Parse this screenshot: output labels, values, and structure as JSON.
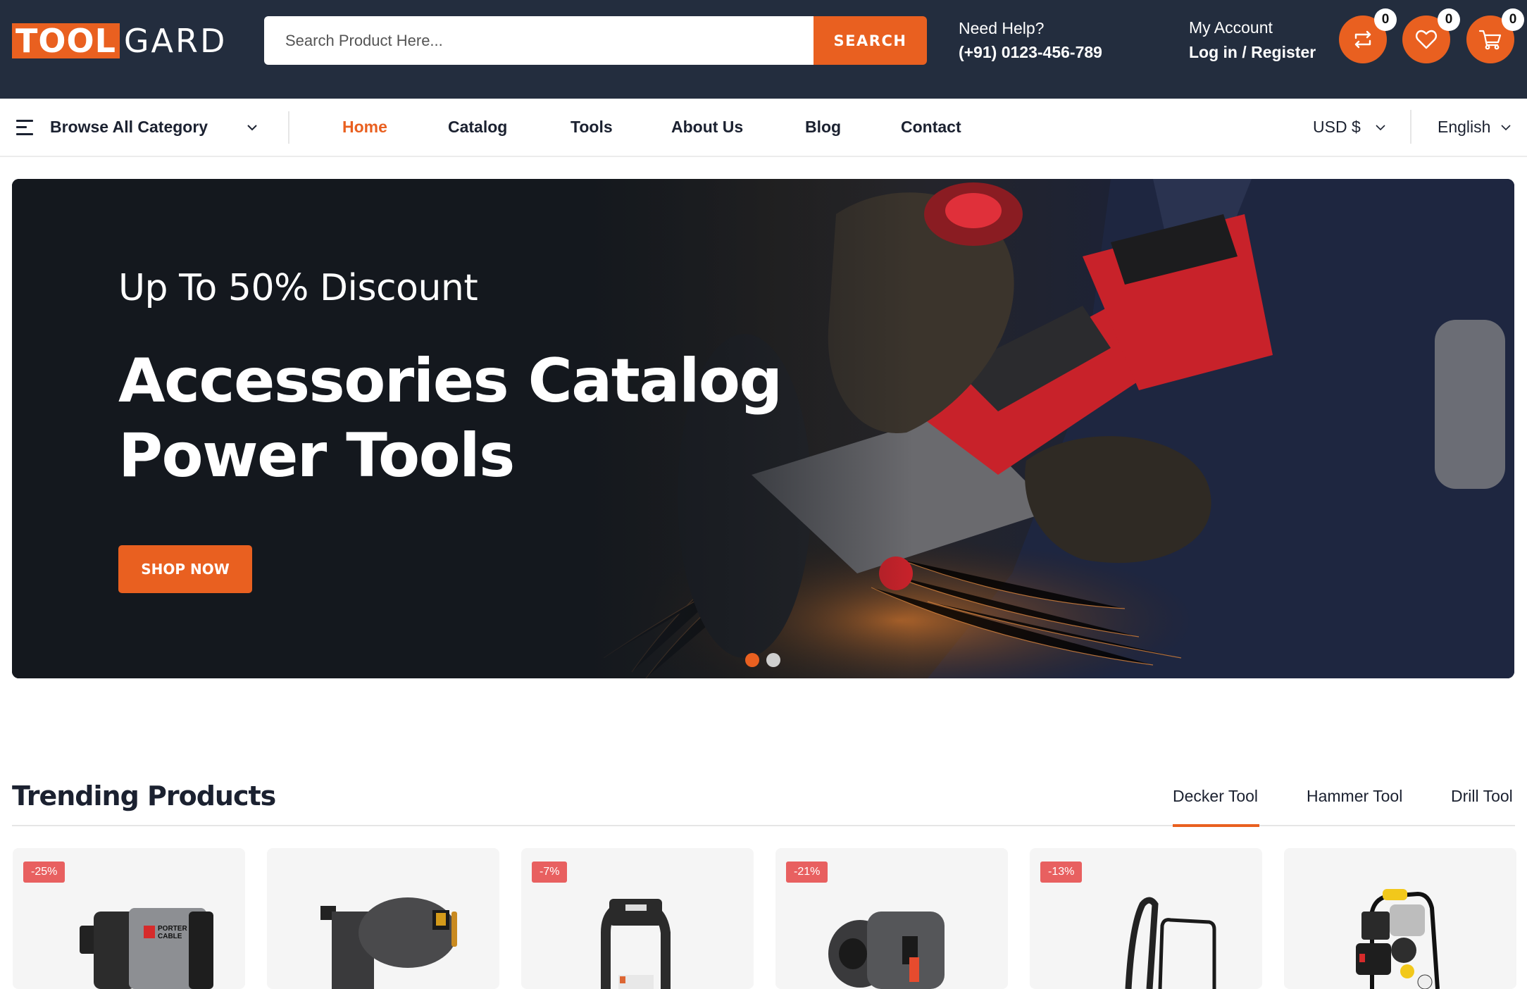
{
  "brand": {
    "logo_part1": "TOOL",
    "logo_part2": "GARD",
    "accent_color": "#e96020",
    "header_bg": "#232d3e"
  },
  "search": {
    "placeholder": "Search Product Here...",
    "value": "",
    "button_label": "SEARCH"
  },
  "help": {
    "label": "Need Help?",
    "phone": "(+91) 0123-456-789"
  },
  "account": {
    "label": "My Account",
    "link": "Log in / Register"
  },
  "header_icons": [
    {
      "icon": "compare-icon",
      "count": "0"
    },
    {
      "icon": "heart-icon",
      "count": "0"
    },
    {
      "icon": "cart-icon",
      "count": "0"
    }
  ],
  "nav": {
    "browse_label": "Browse All Category",
    "links": [
      {
        "label": "Home",
        "active": true
      },
      {
        "label": "Catalog",
        "active": false
      },
      {
        "label": "Tools",
        "active": false
      },
      {
        "label": "About Us",
        "active": false
      },
      {
        "label": "Blog",
        "active": false
      },
      {
        "label": "Contact",
        "active": false
      }
    ],
    "currency": "USD $",
    "language": "English"
  },
  "banner": {
    "subtitle": "Up To 50% Discount",
    "title_line1": "Accessories Catalog",
    "title_line2": "Power Tools",
    "cta_label": "SHOP NOW",
    "slides_total": 2,
    "active_slide": 1
  },
  "trending": {
    "title": "Trending Products",
    "tabs": [
      {
        "label": "Decker Tool",
        "active": true
      },
      {
        "label": "Hammer Tool",
        "active": false
      },
      {
        "label": "Drill Tool",
        "active": false
      }
    ],
    "products": [
      {
        "discount": "-25%",
        "image": "impact-driver"
      },
      {
        "discount": "",
        "image": "nail-gun"
      },
      {
        "discount": "-7%",
        "image": "wet-dry-vacuum"
      },
      {
        "discount": "-21%",
        "image": "rotary-hammer"
      },
      {
        "discount": "-13%",
        "image": "pressure-washer"
      },
      {
        "discount": "",
        "image": "air-compressor"
      }
    ]
  }
}
